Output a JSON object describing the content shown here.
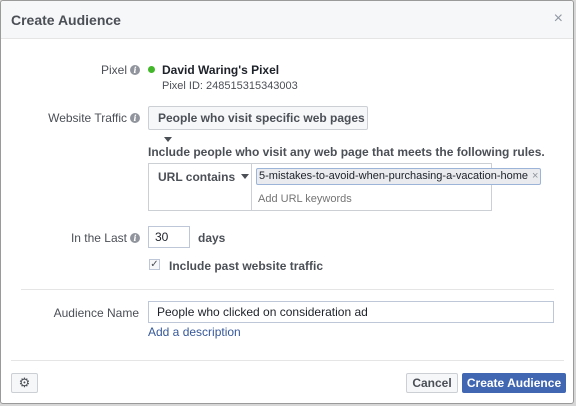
{
  "dialog": {
    "title": "Create Audience",
    "close_glyph": "×"
  },
  "pixel": {
    "label": "Pixel",
    "name": "David Waring's Pixel",
    "id_text": "Pixel ID: 248515315343003",
    "status_color": "#42b72a"
  },
  "website_traffic": {
    "label": "Website Traffic",
    "selected": "People who visit specific web pages"
  },
  "rules": {
    "description": "Include people who visit any web page that meets the following rules.",
    "condition": "URL contains",
    "token": "5-mistakes-to-avoid-when-purchasing-a-vacation-home",
    "token_remove": "×",
    "placeholder": "Add URL keywords"
  },
  "in_the_last": {
    "label": "In the Last",
    "value": "30",
    "unit": "days"
  },
  "include_past": {
    "label": "Include past website traffic",
    "checked": true,
    "check_glyph": "✓"
  },
  "audience_name": {
    "label": "Audience Name",
    "value": "People who clicked on consideration ad",
    "add_description": "Add a description"
  },
  "footer": {
    "cancel": "Cancel",
    "create": "Create Audience",
    "settings_icon": "⚙"
  },
  "colors": {
    "primary": "#4267b2",
    "link": "#365899"
  }
}
